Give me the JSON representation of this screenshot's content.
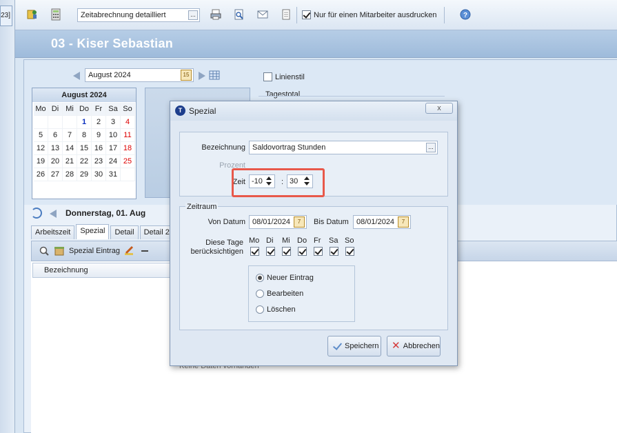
{
  "left_tab": "23]",
  "toolbar": {
    "report_value": "Zeitabrechnung detailliert",
    "report_dots": "...",
    "only_one_label": "Nur für einen Mitarbeiter ausdrucken",
    "only_one_checked": true
  },
  "header": {
    "title": "03 - Kiser Sebastian"
  },
  "date_nav": {
    "month_value": "August 2024",
    "cal_btn": "15"
  },
  "options": {
    "linienstil": "Linienstil",
    "tagestotal": "Tagestotal"
  },
  "calendar": {
    "title": "August 2024",
    "weekdays": [
      "Mo",
      "Di",
      "Mi",
      "Do",
      "Fr",
      "Sa",
      "So"
    ],
    "weeks": [
      [
        "",
        "",
        "",
        "1",
        "2",
        "3",
        "4"
      ],
      [
        "5",
        "6",
        "7",
        "8",
        "9",
        "10",
        "11"
      ],
      [
        "12",
        "13",
        "14",
        "15",
        "16",
        "17",
        "18"
      ],
      [
        "19",
        "20",
        "21",
        "22",
        "23",
        "24",
        "25"
      ],
      [
        "26",
        "27",
        "28",
        "29",
        "30",
        "31",
        ""
      ]
    ]
  },
  "day": {
    "label": "Donnerstag, 01. Aug"
  },
  "tabs": [
    "Arbeitszeit",
    "Spezial",
    "Detail",
    "Detail 2"
  ],
  "subbar": {
    "spezial_label": "Spezial Eintrag"
  },
  "grid": {
    "col_bezeichnung": "Bezeichnung",
    "empty_text": "Keine Daten vorhanden"
  },
  "dialog": {
    "title": "Spezial",
    "logo": "T",
    "close": "x",
    "bezeichnung_label": "Bezeichnung",
    "bezeichnung_value": "Saldovortrag Stunden",
    "bezeichnung_dots": "...",
    "prozent_label": "Prozent",
    "zeit_label": "Zeit",
    "zeit_hours": "-10",
    "zeit_sep": ":",
    "zeit_minutes": "30",
    "zeitraum_title": "Zeitraum",
    "von_label": "Von Datum",
    "von_value": "08/01/2024",
    "bis_label": "Bis Datum",
    "bis_value": "08/01/2024",
    "cal_btn": "7",
    "diese_tage_label_1": "Diese Tage",
    "diese_tage_label_2": "berücksichtigen",
    "days": [
      "Mo",
      "Di",
      "Mi",
      "Do",
      "Fr",
      "Sa",
      "So"
    ],
    "radios": [
      "Neuer Eintrag",
      "Bearbeiten",
      "Löschen"
    ],
    "save": "Speichern",
    "cancel": "Abbrechen"
  }
}
